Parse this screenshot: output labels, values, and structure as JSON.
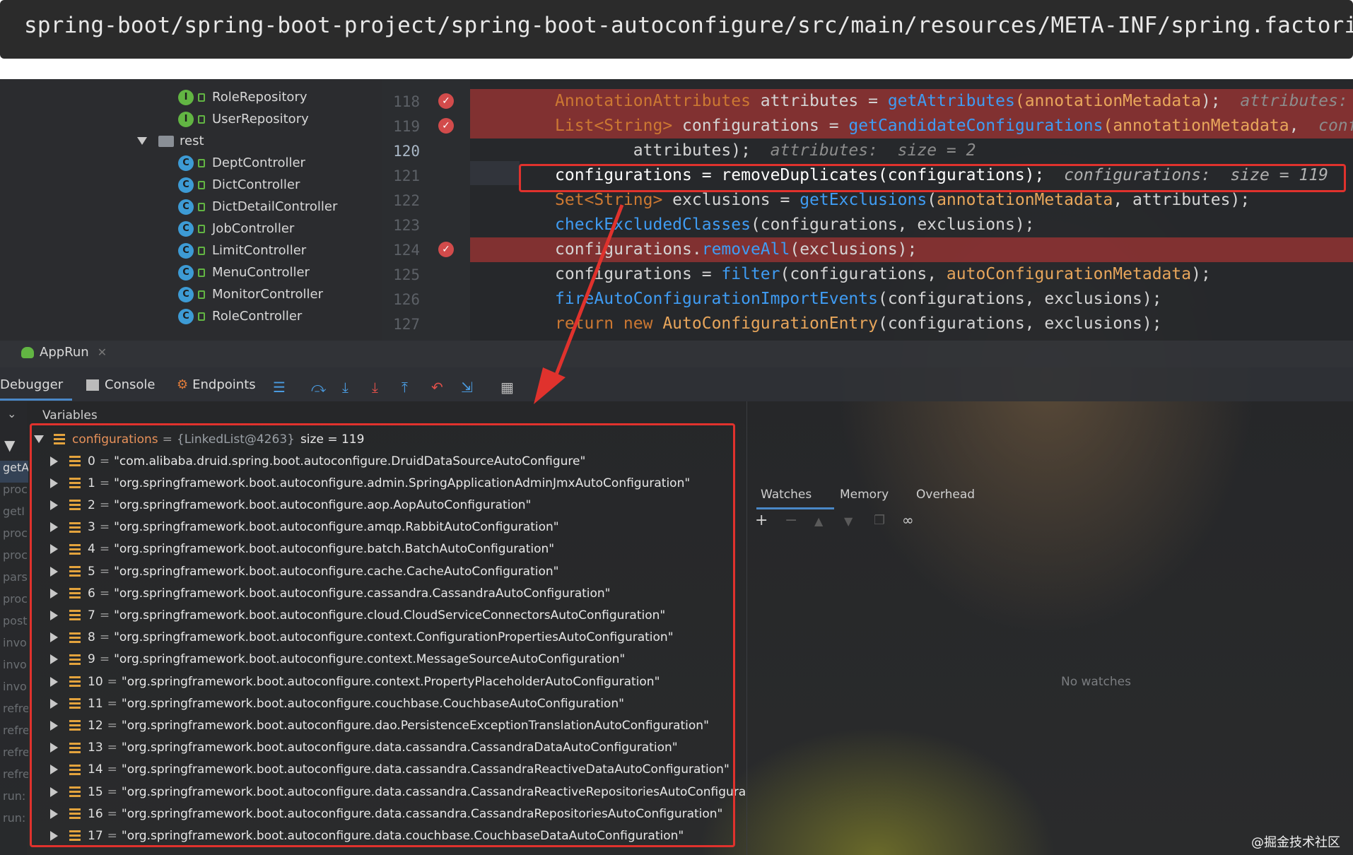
{
  "path_banner": "spring-boot/spring-boot-project/spring-boot-autoconfigure/src/main/resources/META-INF/spring.factories",
  "project_tree": {
    "items": [
      {
        "icon": "I",
        "label": "RoleRepository"
      },
      {
        "icon": "I",
        "label": "UserRepository"
      },
      {
        "folder": true,
        "label": "rest"
      },
      {
        "icon": "C",
        "label": "DeptController"
      },
      {
        "icon": "C",
        "label": "DictController"
      },
      {
        "icon": "C",
        "label": "DictDetailController"
      },
      {
        "icon": "C",
        "label": "JobController"
      },
      {
        "icon": "C",
        "label": "LimitController"
      },
      {
        "icon": "C",
        "label": "MenuController"
      },
      {
        "icon": "C",
        "label": "MonitorController"
      },
      {
        "icon": "C",
        "label": "RoleController"
      }
    ]
  },
  "editor": {
    "line_numbers": [
      "118",
      "119",
      "120",
      "121",
      "122",
      "123",
      "124",
      "125",
      "126",
      "127"
    ],
    "lines": {
      "l118": {
        "a": "AnnotationAttributes",
        "b": " attributes = ",
        "c": "getAttributes",
        "d": "(",
        "e": "annotationMetadata",
        "f": ");  ",
        "g": "attributes: "
      },
      "l119": {
        "a": "List<String>",
        "b": " configurations = ",
        "c": "getCandidateConfigurations",
        "d": "(",
        "e": "annotationMetadata",
        "f": ",  ",
        "g": "conf"
      },
      "l120": {
        "b": "        attributes);  ",
        "g": "attributes:  size = 2"
      },
      "l121": {
        "b": "configurations = removeDuplicates(configurations);  ",
        "g": "configurations:  size = 119"
      },
      "l122": {
        "a": "Set<String>",
        "b": " exclusions = ",
        "c": "getExclusions",
        "d": "(",
        "e": "annotationMetadata",
        "f": ", attributes);"
      },
      "l123": {
        "c": "checkExcludedClasses",
        "b": "(configurations, exclusions);"
      },
      "l124": {
        "b": "configurations.",
        "c": "removeAll",
        "f": "(exclusions);"
      },
      "l125": {
        "b": "configurations = ",
        "c": "filter",
        "d": "(configurations, ",
        "e": "autoConfigurationMetadata",
        "f": ");"
      },
      "l126": {
        "c": "fireAutoConfigurationImportEvents",
        "b": "(configurations, exclusions);"
      },
      "l127": {
        "a": "return new ",
        "b": "AutoConfigurationEntry",
        "f": "(configurations, exclusions);"
      }
    }
  },
  "run_tab": {
    "label": "AppRun"
  },
  "debugger_toolbar": {
    "debugger": "Debugger",
    "console": "Console",
    "endpoints": "Endpoints"
  },
  "frames": [
    "getA",
    "proc",
    "getI",
    "proc",
    "proc",
    "pars",
    "proc",
    "post",
    "invo",
    "invo",
    "invo",
    "refre",
    "refre",
    "refre",
    "refre",
    "run:",
    "run:"
  ],
  "variables": {
    "header": "Variables",
    "root": {
      "name": "configurations",
      "eq": " = ",
      "type": "{LinkedList@4263}",
      "size": "size = 119"
    },
    "items": [
      {
        "idx": "0",
        "val": "\"com.alibaba.druid.spring.boot.autoconfigure.DruidDataSourceAutoConfigure\""
      },
      {
        "idx": "1",
        "val": "\"org.springframework.boot.autoconfigure.admin.SpringApplicationAdminJmxAutoConfiguration\""
      },
      {
        "idx": "2",
        "val": "\"org.springframework.boot.autoconfigure.aop.AopAutoConfiguration\""
      },
      {
        "idx": "3",
        "val": "\"org.springframework.boot.autoconfigure.amqp.RabbitAutoConfiguration\""
      },
      {
        "idx": "4",
        "val": "\"org.springframework.boot.autoconfigure.batch.BatchAutoConfiguration\""
      },
      {
        "idx": "5",
        "val": "\"org.springframework.boot.autoconfigure.cache.CacheAutoConfiguration\""
      },
      {
        "idx": "6",
        "val": "\"org.springframework.boot.autoconfigure.cassandra.CassandraAutoConfiguration\""
      },
      {
        "idx": "7",
        "val": "\"org.springframework.boot.autoconfigure.cloud.CloudServiceConnectorsAutoConfiguration\""
      },
      {
        "idx": "8",
        "val": "\"org.springframework.boot.autoconfigure.context.ConfigurationPropertiesAutoConfiguration\""
      },
      {
        "idx": "9",
        "val": "\"org.springframework.boot.autoconfigure.context.MessageSourceAutoConfiguration\""
      },
      {
        "idx": "10",
        "val": "\"org.springframework.boot.autoconfigure.context.PropertyPlaceholderAutoConfiguration\""
      },
      {
        "idx": "11",
        "val": "\"org.springframework.boot.autoconfigure.couchbase.CouchbaseAutoConfiguration\""
      },
      {
        "idx": "12",
        "val": "\"org.springframework.boot.autoconfigure.dao.PersistenceExceptionTranslationAutoConfiguration\""
      },
      {
        "idx": "13",
        "val": "\"org.springframework.boot.autoconfigure.data.cassandra.CassandraDataAutoConfiguration\""
      },
      {
        "idx": "14",
        "val": "\"org.springframework.boot.autoconfigure.data.cassandra.CassandraReactiveDataAutoConfiguration\""
      },
      {
        "idx": "15",
        "val": "\"org.springframework.boot.autoconfigure.data.cassandra.CassandraReactiveRepositoriesAutoConfigura"
      },
      {
        "idx": "16",
        "val": "\"org.springframework.boot.autoconfigure.data.cassandra.CassandraRepositoriesAutoConfiguration\""
      },
      {
        "idx": "17",
        "val": "\"org.springframework.boot.autoconfigure.data.couchbase.CouchbaseDataAutoConfiguration\""
      }
    ]
  },
  "watches": {
    "tabs": [
      "Watches",
      "Memory",
      "Overhead"
    ],
    "empty": "No watches"
  },
  "watermark": "@掘金技术社区",
  "colors": {
    "highlight_box": "#e0322d",
    "breakpoint_line": "#a03434",
    "current_line": "#b5b9ee"
  }
}
